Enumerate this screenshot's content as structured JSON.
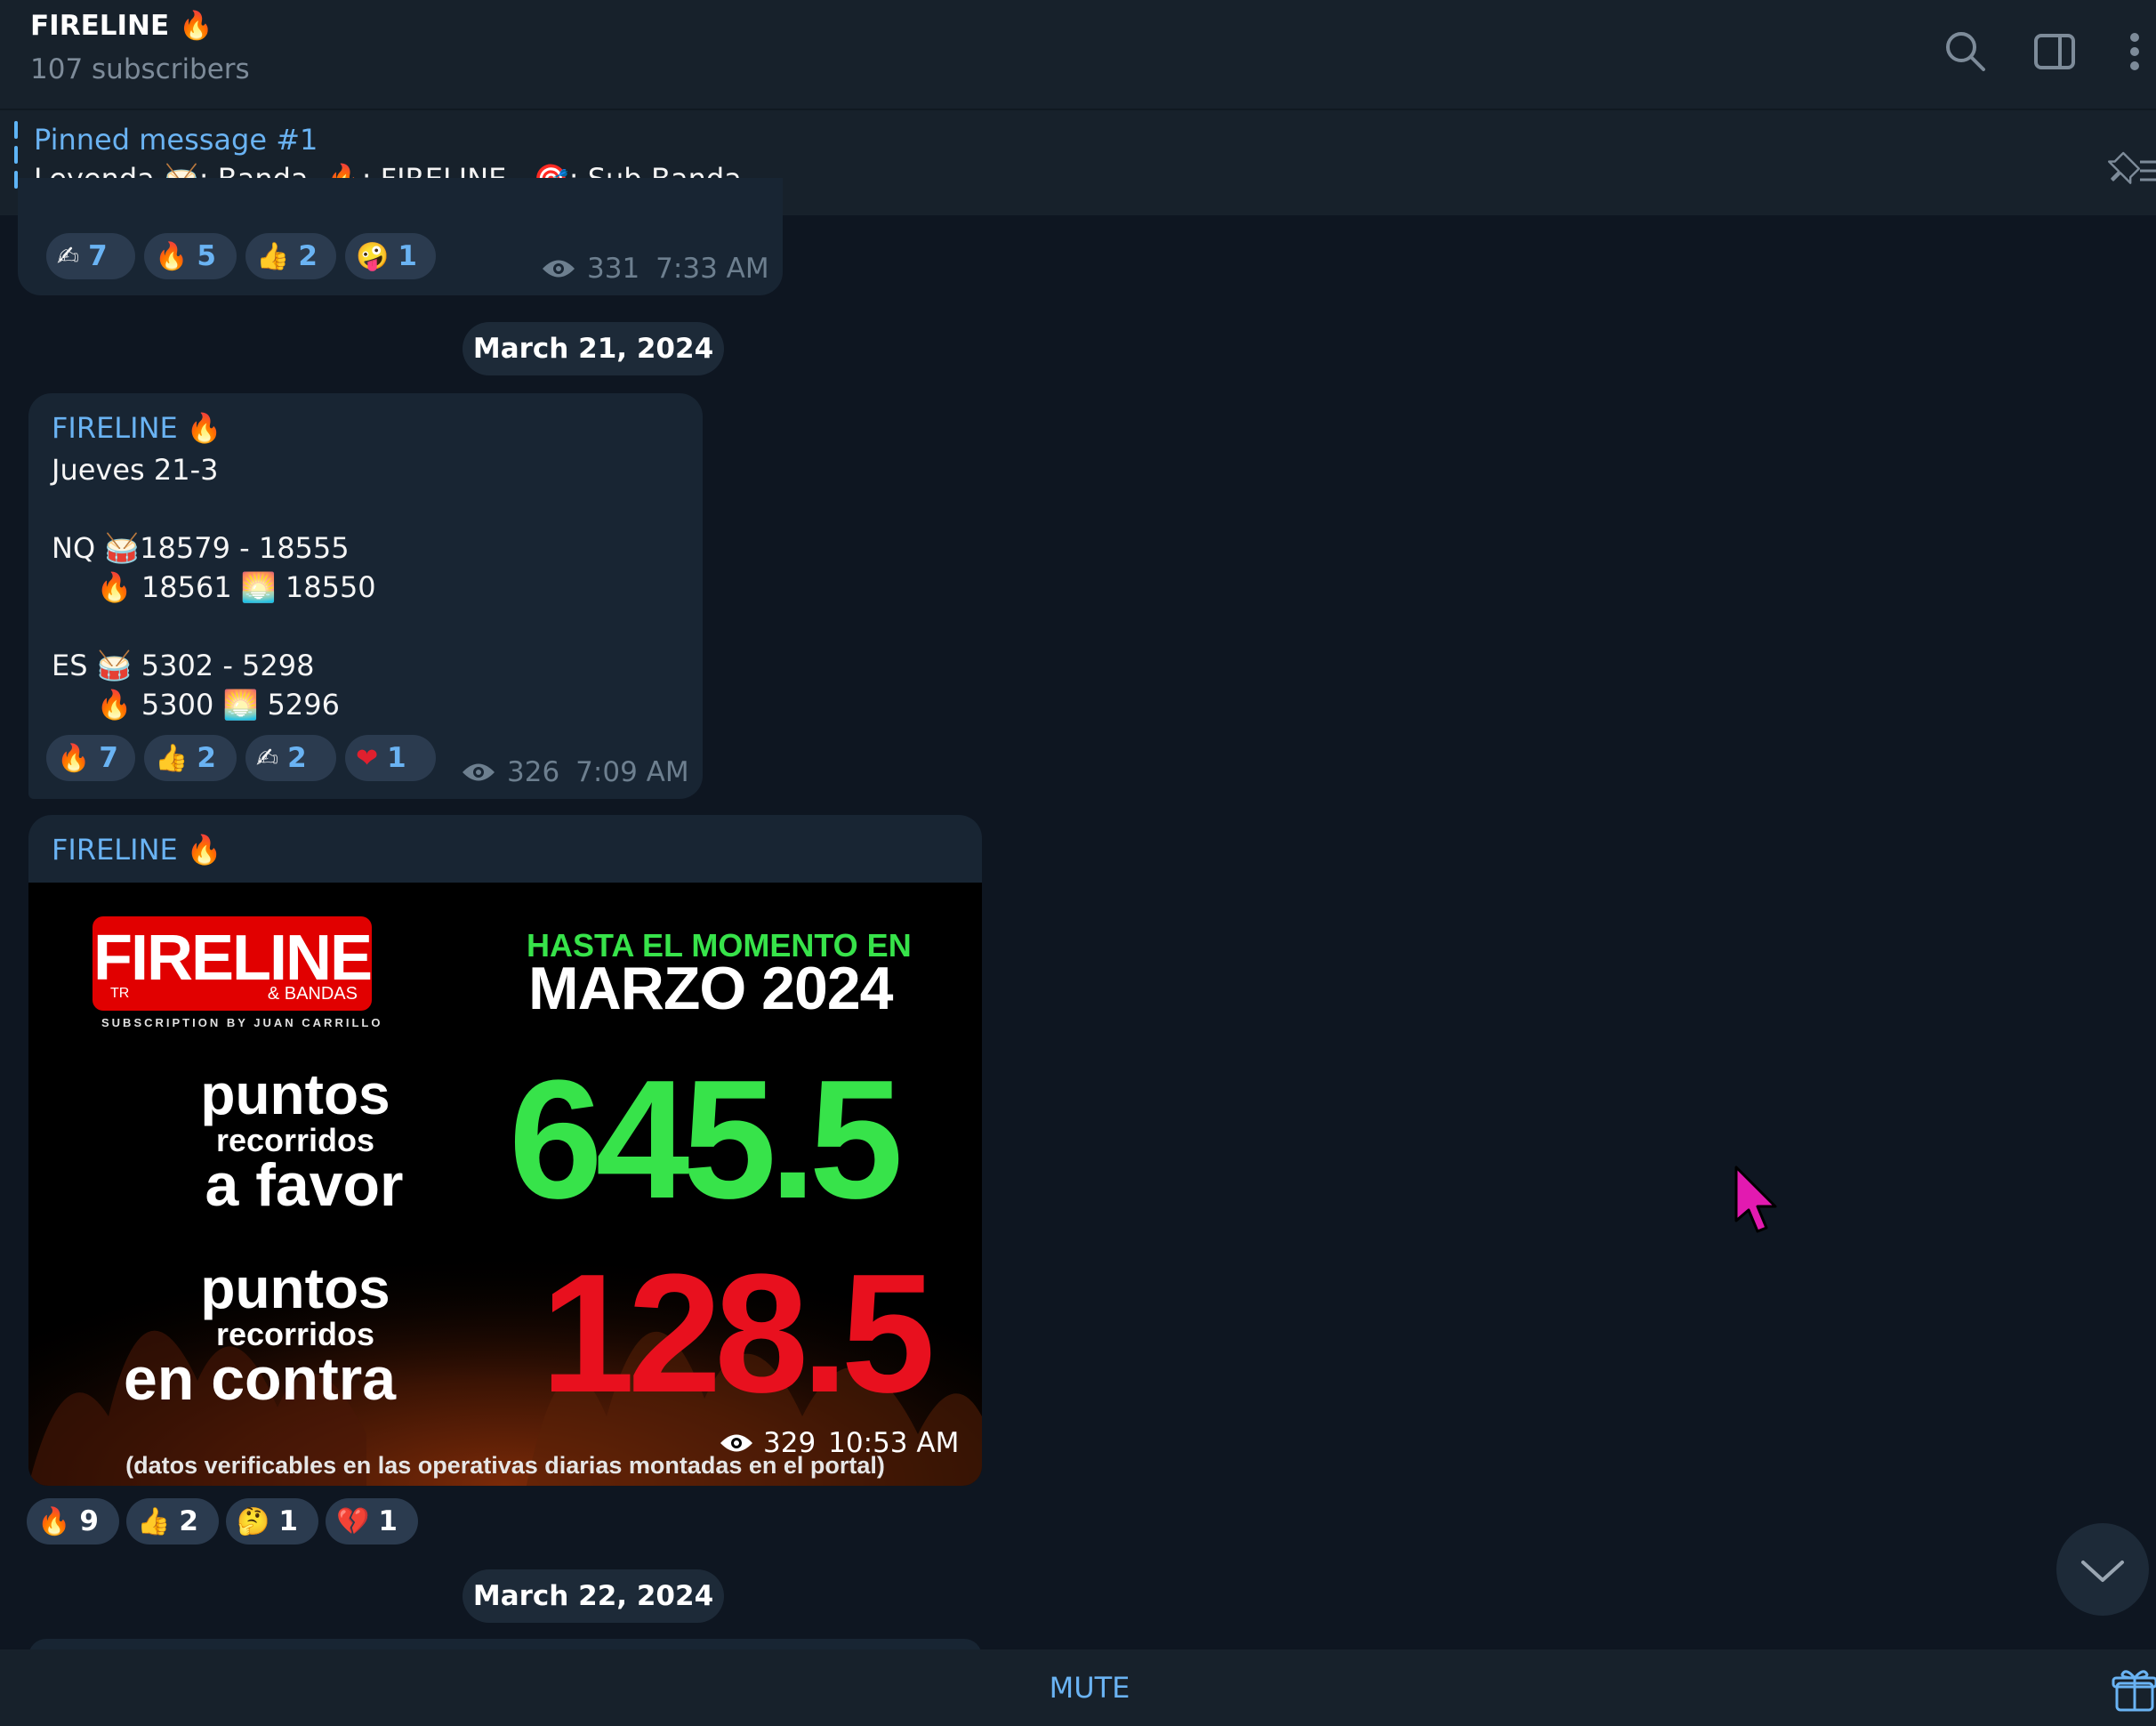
{
  "header": {
    "title": "FIRELINE 🔥",
    "subscribers": "107 subscribers",
    "icons": [
      "search-icon",
      "sidebar-toggle-icon",
      "more-icon"
    ]
  },
  "pinned": {
    "title": "Pinned message #1",
    "text": "Leyenda 🥁: Banda  🔥: FIRELINE   🎯: Sub-Banda"
  },
  "messages": [
    {
      "reactions": [
        {
          "emoji": "✍",
          "count": "7"
        },
        {
          "emoji": "🔥",
          "count": "5"
        },
        {
          "emoji": "👍",
          "count": "2"
        },
        {
          "emoji": "🤪",
          "count": "1"
        }
      ],
      "views": "331",
      "time": "7:33 AM"
    },
    {
      "date": "March 21, 2024",
      "sender": "FIRELINE 🔥",
      "lines": [
        "Jueves 21-3",
        "",
        "NQ 🥁18579 - 18555",
        "     🔥 18561 🌅 18550",
        "",
        "ES 🥁 5302 - 5298",
        "     🔥 5300 🌅 5296"
      ],
      "reactions": [
        {
          "emoji": "🔥",
          "count": "7"
        },
        {
          "emoji": "👍",
          "count": "2"
        },
        {
          "emoji": "✍",
          "count": "2"
        },
        {
          "emoji": "❤",
          "count": "1"
        }
      ],
      "views": "326",
      "time": "7:09 AM"
    },
    {
      "sender": "FIRELINE 🔥",
      "poster": {
        "logo": "FIRELINE",
        "logo_tr": "TR",
        "logo_bandas": "& BANDAS",
        "logo_sub": "SUBSCRIPTION BY JUAN CARRILLO",
        "heading_1": "HASTA EL MOMENTO EN",
        "heading_2": "MARZO 2024",
        "favor_1": "puntos",
        "favor_2": "recorridos",
        "favor_3": "a favor",
        "favor_value": "645.5",
        "contra_1": "puntos",
        "contra_2": "recorridos",
        "contra_3": "en contra",
        "contra_value": "128.5",
        "footer": "(datos verificables en las operativas diarias montadas en el portal)"
      },
      "views": "329",
      "time": "10:53 AM",
      "reactions": [
        {
          "emoji": "🔥",
          "count": "9"
        },
        {
          "emoji": "👍",
          "count": "2"
        },
        {
          "emoji": "🤔",
          "count": "1"
        },
        {
          "emoji": "💔",
          "count": "1"
        }
      ]
    },
    {
      "date": "March 22, 2024"
    }
  ],
  "bottom": {
    "mute_label": "MUTE"
  },
  "colors": {
    "background": "#0e1621",
    "panel": "#17212b",
    "bubble": "#182533",
    "accent": "#6ab3f3",
    "green": "#37e34a",
    "red": "#e8101e",
    "cursor": "#e21ab0"
  }
}
